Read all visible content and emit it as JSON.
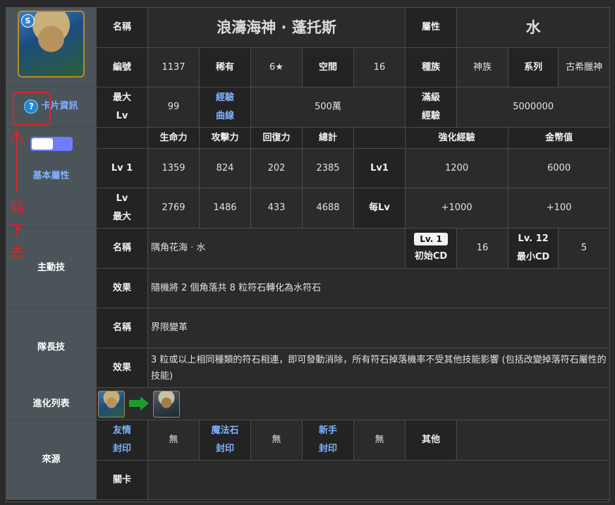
{
  "header": {
    "name_label": "名稱",
    "name_value": "浪濤海神 · 蓬托斯",
    "attr_label": "屬性",
    "attr_value": "水"
  },
  "row2": {
    "id_label": "編號",
    "id_value": "1137",
    "rarity_label": "稀有",
    "rarity_value": "6★",
    "space_label": "空間",
    "space_value": "16",
    "race_label": "種族",
    "race_value": "神族",
    "series_label": "系列",
    "series_value": "古希臘神"
  },
  "row3": {
    "maxlv_label_1": "最大",
    "maxlv_label_2": "Lv",
    "maxlv_value": "99",
    "curve_label_1": "經驗",
    "curve_label_2": "曲線",
    "curve_value": "500萬",
    "fullexp_label_1": "滿級",
    "fullexp_label_2": "經驗",
    "fullexp_value": "5000000"
  },
  "sidebar": {
    "info_label": "卡片資訊",
    "basic_label": "基本屬性",
    "active_label": "主動技",
    "leader_label": "隊長技",
    "evo_label": "進化列表",
    "source_label": "來源",
    "toggle_state": "on",
    "toggle_color": "#6f7cff"
  },
  "stats": {
    "headers": [
      "生命力",
      "攻擊力",
      "回復力",
      "總計",
      "強化經驗",
      "金幣值"
    ],
    "lv1": {
      "label": "Lv 1",
      "hp": "1359",
      "atk": "824",
      "rec": "202",
      "total": "2385",
      "exp_label": "Lv1",
      "exp": "1200",
      "coin": "6000"
    },
    "lvmax": {
      "label_1": "Lv",
      "label_2": "最大",
      "hp": "2769",
      "atk": "1486",
      "rec": "433",
      "total": "4688",
      "exp_label": "每Lv",
      "exp": "+1000",
      "coin": "+100"
    }
  },
  "active_skill": {
    "name_label": "名稱",
    "name": "隅角花海 · 水",
    "lv_pill": "Lv. 1",
    "initial_cd_label": "初始CD",
    "initial_cd": "16",
    "max_lv_label": "Lv. 12",
    "min_cd_label": "最小CD",
    "min_cd": "5",
    "effect_label": "效果",
    "effect": "隨機將 2 個角落共 8 粒符石轉化為水符石"
  },
  "leader_skill": {
    "name_label": "名稱",
    "name": "界限變革",
    "effect_label": "效果",
    "effect": "3 粒或以上相同種類的符石相連，即可發動消除，所有符石掉落機率不受其他技能影響 (包括改變掉落符石屬性的技能)"
  },
  "source": {
    "friend_1": "友情",
    "friend_2": "封印",
    "friend_value": "無",
    "magic_1": "魔法石",
    "magic_2": "封印",
    "magic_value": "無",
    "newbie_1": "新手",
    "newbie_2": "封印",
    "newbie_value": "無",
    "other_label": "其他",
    "other_value": "",
    "stage_label": "關卡",
    "stage_value": ""
  },
  "annotation": {
    "text": "點下去",
    "color": "#e0202a"
  },
  "colors": {
    "sidebar": "#4a5459",
    "link": "#7fb2ff",
    "cell": "#272727"
  }
}
